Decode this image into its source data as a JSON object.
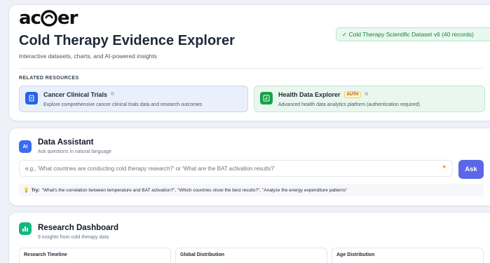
{
  "header": {
    "logo_text": "acer",
    "title": "Cold Therapy Evidence Explorer",
    "subtitle": "Interactive datasets, charts, and AI-powered insights",
    "dataset_badge": "✓ Cold Therapy Scientific Dataset v6 (40 records)"
  },
  "resources": {
    "label": "RELATED RESOURCES",
    "items": [
      {
        "title": "Cancer Clinical Trials",
        "description": "Explore comprehensive cancer clinical trials data and research outcomes",
        "icon": "document-icon"
      },
      {
        "title": "Health Data Explorer",
        "badge": "AUTH",
        "description": "Advanced health data analytics platform (authentication required)",
        "icon": "chart-icon"
      }
    ]
  },
  "assistant": {
    "icon_label": "AI",
    "title": "Data Assistant",
    "subtitle": "Ask questions in natural language",
    "placeholder": "e.g., 'What countries are conducting cold therapy research?' or 'What are the BAT activation results?'",
    "ask_label": "Ask",
    "try_label": "Try:",
    "try_examples": "\"What's the correlation between temperature and BAT activation?\", \"Which countries show the best results?\", \"Analyze the energy expenditure patterns\""
  },
  "dashboard": {
    "title": "Research Dashboard",
    "subtitle": "9 insights from cold therapy data",
    "panels": [
      "Research Timeline",
      "Global Distribution",
      "Age Distribution"
    ]
  },
  "colors": {
    "accent": "#5b67e8",
    "success": "#15803d",
    "cancer_icon": "#2563eb",
    "health_icon": "#16a34a"
  }
}
